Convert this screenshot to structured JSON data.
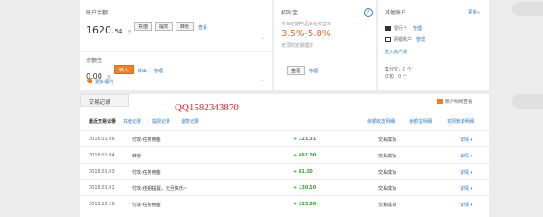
{
  "account": {
    "title": "账户余额",
    "balance_int": "1620.",
    "balance_dec": "54",
    "unit": "元",
    "buttons": [
      "充值",
      "提现",
      "转账"
    ],
    "view_link": "查看"
  },
  "yuebao": {
    "title": "余额宝",
    "balance": "0.00",
    "unit": "元",
    "transfer_in": "转入",
    "transfer_out": "转出",
    "separator": "|",
    "manage": "管理",
    "more_rewards": "更多福利"
  },
  "zhaocaibao": {
    "title": "招财宝",
    "help_icon": "?",
    "desc": "今日定期产品年化收益率",
    "rate": "3.5%-5.8%",
    "sub": "无须的定期理财",
    "view_btn": "查看",
    "manage": "管理"
  },
  "other_accounts": {
    "title": "其他账户",
    "more": "更多»",
    "bank_card_label": "银行卡",
    "bank_card_link": "管理",
    "online_bank_label": "网银账户",
    "online_bank_link": "管理",
    "housing_fund": "进入账户通",
    "points": "集分宝：0 个",
    "red_packet": "红包：0 个"
  },
  "transactions": {
    "section_title": "交易记录",
    "watermark": "QQ1582343870",
    "scan_link": "账户明细查看",
    "filters": [
      "最近交易记录",
      "充值记录",
      "提现记录",
      "退款记录"
    ],
    "filter_sep": "|",
    "right_links": [
      "余额收支明细",
      "余额宝明细",
      "花呗账单明细"
    ],
    "rows": [
      {
        "date": "2016.01.06",
        "desc": "付款-任务佣金",
        "amount": "+ 121.31",
        "status": "交易成功",
        "detail": "详情 ▾"
      },
      {
        "date": "2016.01.04",
        "desc": "转账",
        "amount": "+ 661.00",
        "status": "交易成功",
        "detail": "详情 ▾"
      },
      {
        "date": "2016.01.03",
        "desc": "付款-任务佣金",
        "amount": "+ 81.50",
        "status": "交易成功",
        "detail": "详情 ▾"
      },
      {
        "date": "2016.01.01",
        "desc": "付款-佳期提醒，元旦快乐~",
        "amount": "+ 130.50",
        "status": "交易成功",
        "detail": "详情 ▾"
      },
      {
        "date": "2015.12.29",
        "desc": "付款-任务佣金",
        "amount": "+ 225.00",
        "status": "交易成功",
        "detail": "详情 ▾"
      }
    ]
  },
  "colors": {
    "accent": "#f2811d",
    "link": "#2a78c7",
    "amount": "#35a435",
    "rate": "#ef6a1f"
  }
}
